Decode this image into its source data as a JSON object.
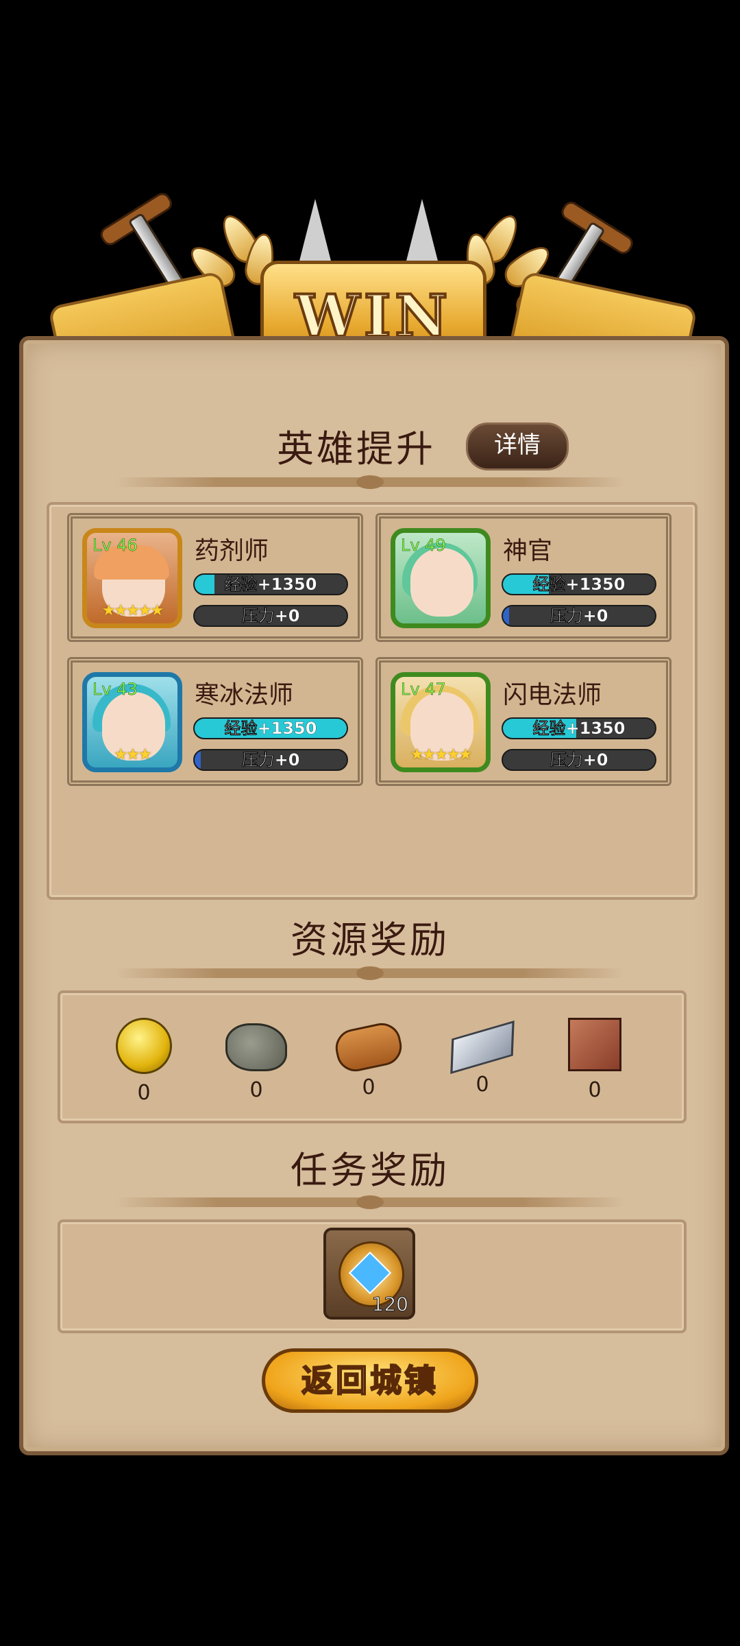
{
  "banner": {
    "title": "WIN"
  },
  "hero_section": {
    "title": "英雄提升",
    "detail_button": "详情",
    "heroes": [
      {
        "name": "药剂师",
        "level": "Lv 46",
        "stars": "★★★★★",
        "exp": "经验+1350",
        "exp_fill": 0.13,
        "pressure": "压力+0",
        "pressure_fill": 0.0,
        "frame_color": "#c8871a"
      },
      {
        "name": "神官",
        "level": "Lv 49",
        "stars": "",
        "exp": "经验+1350",
        "exp_fill": 0.3,
        "pressure": "压力+0",
        "pressure_fill": 0.04,
        "frame_color": "#3f8a1f"
      },
      {
        "name": "寒冰法师",
        "level": "Lv 43",
        "stars": "★★★",
        "exp": "经验+1350",
        "exp_fill": 1.0,
        "pressure": "压力+0",
        "pressure_fill": 0.04,
        "frame_color": "#1e78a8"
      },
      {
        "name": "闪电法师",
        "level": "Lv 47",
        "stars": "★★★★★",
        "exp": "经验+1350",
        "exp_fill": 0.48,
        "pressure": "压力+0",
        "pressure_fill": 0.0,
        "frame_color": "#3f8a1f"
      }
    ]
  },
  "resource_section": {
    "title": "资源奖励",
    "items": [
      {
        "icon": "gold-coin-icon",
        "count": "0"
      },
      {
        "icon": "stone-icon",
        "count": "0"
      },
      {
        "icon": "wood-log-icon",
        "count": "0"
      },
      {
        "icon": "iron-ingot-icon",
        "count": "0"
      },
      {
        "icon": "leather-icon",
        "count": "0"
      }
    ]
  },
  "mission_section": {
    "title": "任务奖励",
    "reward": {
      "icon": "star-medal-icon",
      "count": "120"
    }
  },
  "return_button": "返回城镇",
  "colors": {
    "parchment": "#d6bd9c",
    "exp_bar": "#27c9d6",
    "pressure_bar": "#2f63c8",
    "gold": "#f0a51c"
  }
}
